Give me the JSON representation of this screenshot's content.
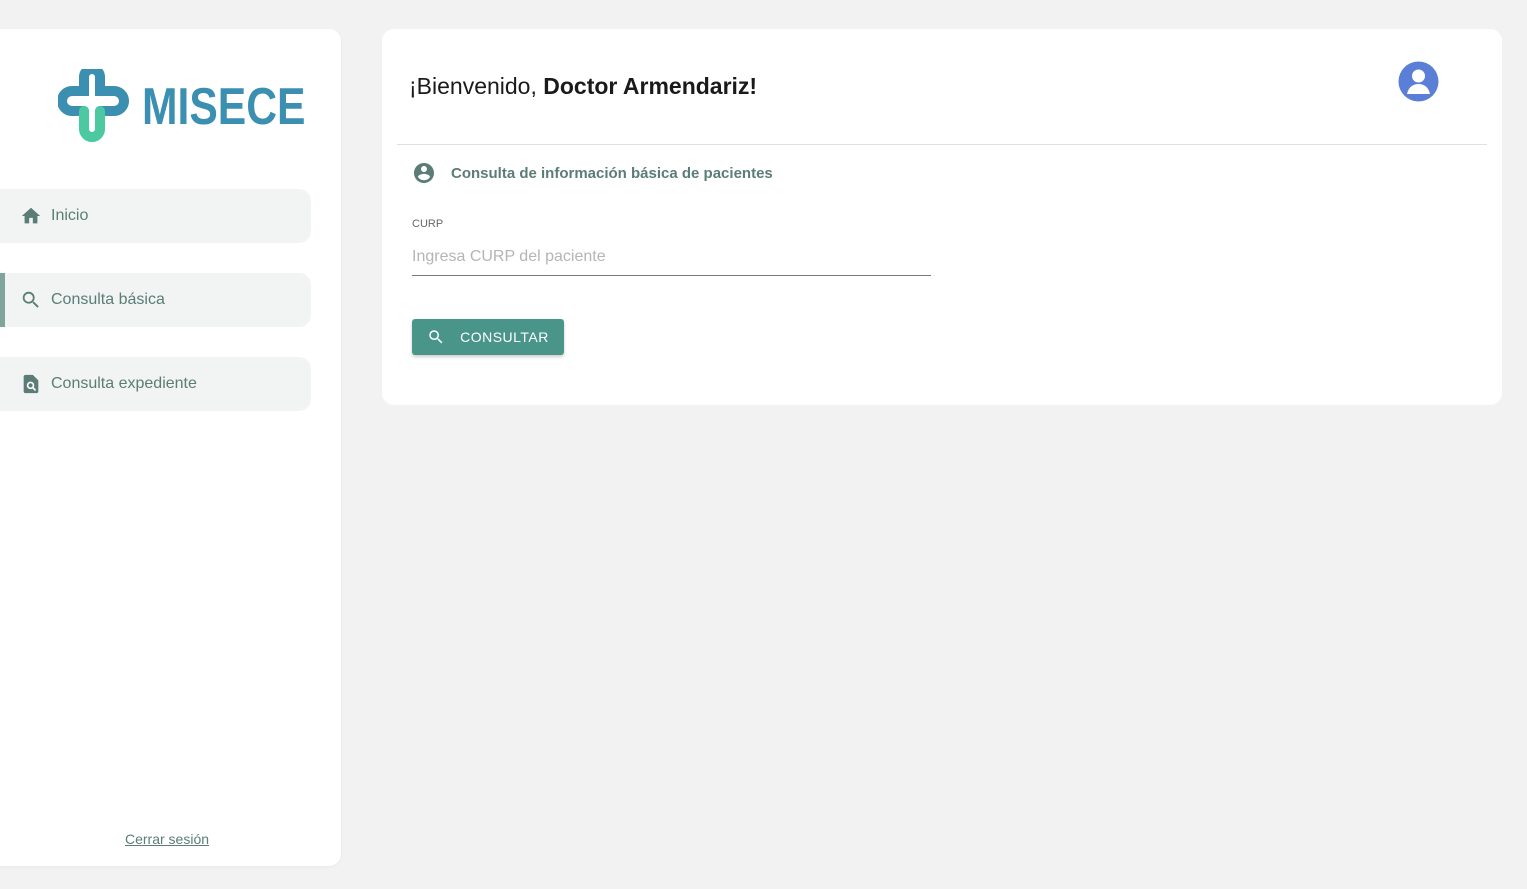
{
  "brand": {
    "name": "MISECE"
  },
  "sidebar": {
    "items": [
      {
        "label": "Inicio",
        "icon": "home-icon",
        "active": false
      },
      {
        "label": "Consulta básica",
        "icon": "search-icon",
        "active": true
      },
      {
        "label": "Consulta expediente",
        "icon": "document-search-icon",
        "active": false
      }
    ],
    "logout_label": "Cerrar sesión"
  },
  "header": {
    "greeting": "¡Bienvenido, ",
    "user_name": "Doctor Armendariz!"
  },
  "section": {
    "title": "Consulta de información básica de pacientes",
    "icon": "account-circle-icon"
  },
  "form": {
    "curp_label": "CURP",
    "curp_placeholder": "Ingresa CURP del paciente",
    "curp_value": "",
    "submit_label": "CONSULTAR"
  },
  "colors": {
    "accent": "#4a958a",
    "nav_text": "#5b7d76",
    "nav_bg": "#f1f4f3",
    "brand_blue": "#3b8fb0",
    "brand_green": "#4cc9a0",
    "avatar": "#5b7fd6"
  }
}
